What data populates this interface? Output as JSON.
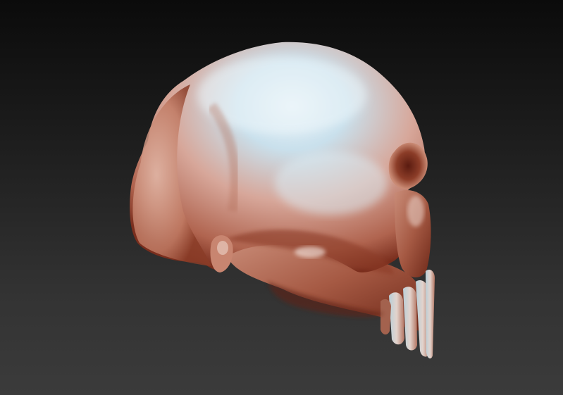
{
  "viewport": {
    "background_top": "#0b0b0b",
    "background_bottom": "#3b3b3b"
  },
  "model": {
    "object": "skull-sculpt",
    "material_colors": {
      "highlight": "#cfe6f3",
      "base": "#d8a391",
      "shadow": "#7a2e1d"
    }
  }
}
